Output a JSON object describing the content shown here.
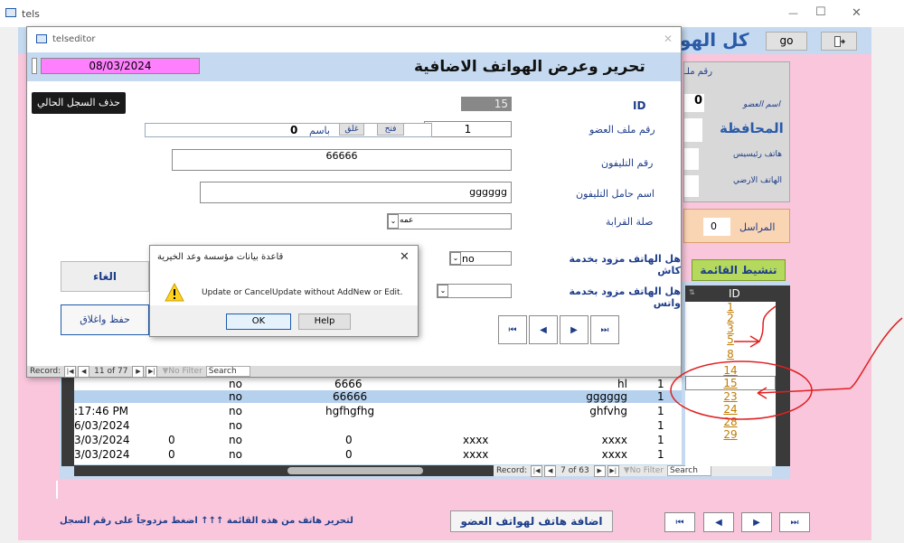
{
  "main_window": {
    "title": "tels",
    "app_icon": "form-icon",
    "controls": {
      "minimize": "—",
      "maximize": "☐",
      "close": "✕"
    }
  },
  "main_form": {
    "header_title_fragment": "كل الهو",
    "go_label": "go",
    "exit_icon": "exit-door-icon",
    "file_number_label": "رقم ملـ",
    "member_name_label": "اسم العضو",
    "member_name_value": "0",
    "governorate_label": "المحافظة",
    "main_phone_label": "هاتف رئيسيس",
    "landline_label": "الهاتف الارضي",
    "correspondent_label": "المراسل",
    "correspondent_value": "0",
    "refresh_list_label": "تنشيط القائمة",
    "add_phone_label": "اضافة هاتف لهواتف العضو",
    "hint_text": "لتحرير هاتف من هذه القائمة ↑↑↑ اضغط مزدوجاً على رقم السجل"
  },
  "id_list": {
    "header": "ID",
    "ids": [
      "1",
      "2",
      "3",
      "5",
      "8",
      "14",
      "15",
      "23",
      "24",
      "28",
      "29"
    ],
    "selected_id": "15"
  },
  "grid": {
    "rows": [
      {
        "date": "",
        "col2": "",
        "col3": "no",
        "col4": "6666",
        "col5": "",
        "col6": "hl",
        "col7": "1"
      },
      {
        "date": "",
        "col2": "",
        "col3": "no",
        "col4": "66666",
        "col5": "",
        "col6": "gggggg",
        "col7": "1"
      },
      {
        "date": ":17:46 PM",
        "col2": "",
        "col3": "no",
        "col4": "hgfhgfhg",
        "col5": "",
        "col6": "ghfvhg",
        "col7": "1"
      },
      {
        "date": "6/03/2024",
        "col2": "",
        "col3": "no",
        "col4": "",
        "col5": "",
        "col6": "",
        "col7": "1"
      },
      {
        "date": "3/03/2024",
        "col2": "0",
        "col3": "no",
        "col4": "0",
        "col5": "xxxx",
        "col6": "xxxx",
        "col7": "1"
      },
      {
        "date": "3/03/2024",
        "col2": "0",
        "col3": "no",
        "col4": "0",
        "col5": "xxxx",
        "col6": "xxxx",
        "col7": "1"
      }
    ],
    "record_label": "Record:",
    "record_position": "7 of 63",
    "filter_label": "No Filter",
    "search_label": "Search"
  },
  "editor_dialog": {
    "title": "telseditor",
    "date": "08/03/2024",
    "heading": "تحرير وعرض الهواتف الاضافية",
    "delete_record_label": "حذف السجل الحالي",
    "id_label": "ID",
    "id_value": "15",
    "member_file_label": "رقم ملف العضو",
    "member_file_value": "1",
    "open_label": "فتح",
    "close_small_label": "غلق",
    "name_label": "باسم",
    "name_value": "0",
    "phone_label": "رقم التليفون",
    "phone_value": "66666",
    "holder_label": "اسم حامل التليفون",
    "holder_value": "gggggg",
    "relation_label": "صلة القرابة",
    "relation_value": "عمه",
    "cash_label": "هل الهاتف مزود بخدمة كاش",
    "cash_value": "no",
    "whatsapp_label": "هل الهاتف مزود بخدمة واتس",
    "whatsapp_value": "",
    "cancel_label": "الغاء",
    "save_close_label": "حفظ واغلاق",
    "record_label": "Record:",
    "record_position": "11 of 77",
    "filter_label": "No Filter",
    "search_label": "Search"
  },
  "nav_buttons": {
    "first": "⏮",
    "prev": "◀",
    "next": "▶",
    "last": "⏭"
  },
  "message_box": {
    "title": "قاعدة بيانات مؤسسة وعد الخيرية",
    "message": "Update or CancelUpdate without AddNew or Edit.",
    "ok_label": "OK",
    "help_label": "Help",
    "icon": "warning-icon"
  },
  "colors": {
    "form_background": "#f9c6dc",
    "dialog_header": "#c5daf0",
    "date_field": "#ff80ff",
    "refresh_button": "#b4d95c",
    "correspondent_panel": "#f9d5b4",
    "annotation": "#e02020",
    "id_link": "#c07b00"
  }
}
